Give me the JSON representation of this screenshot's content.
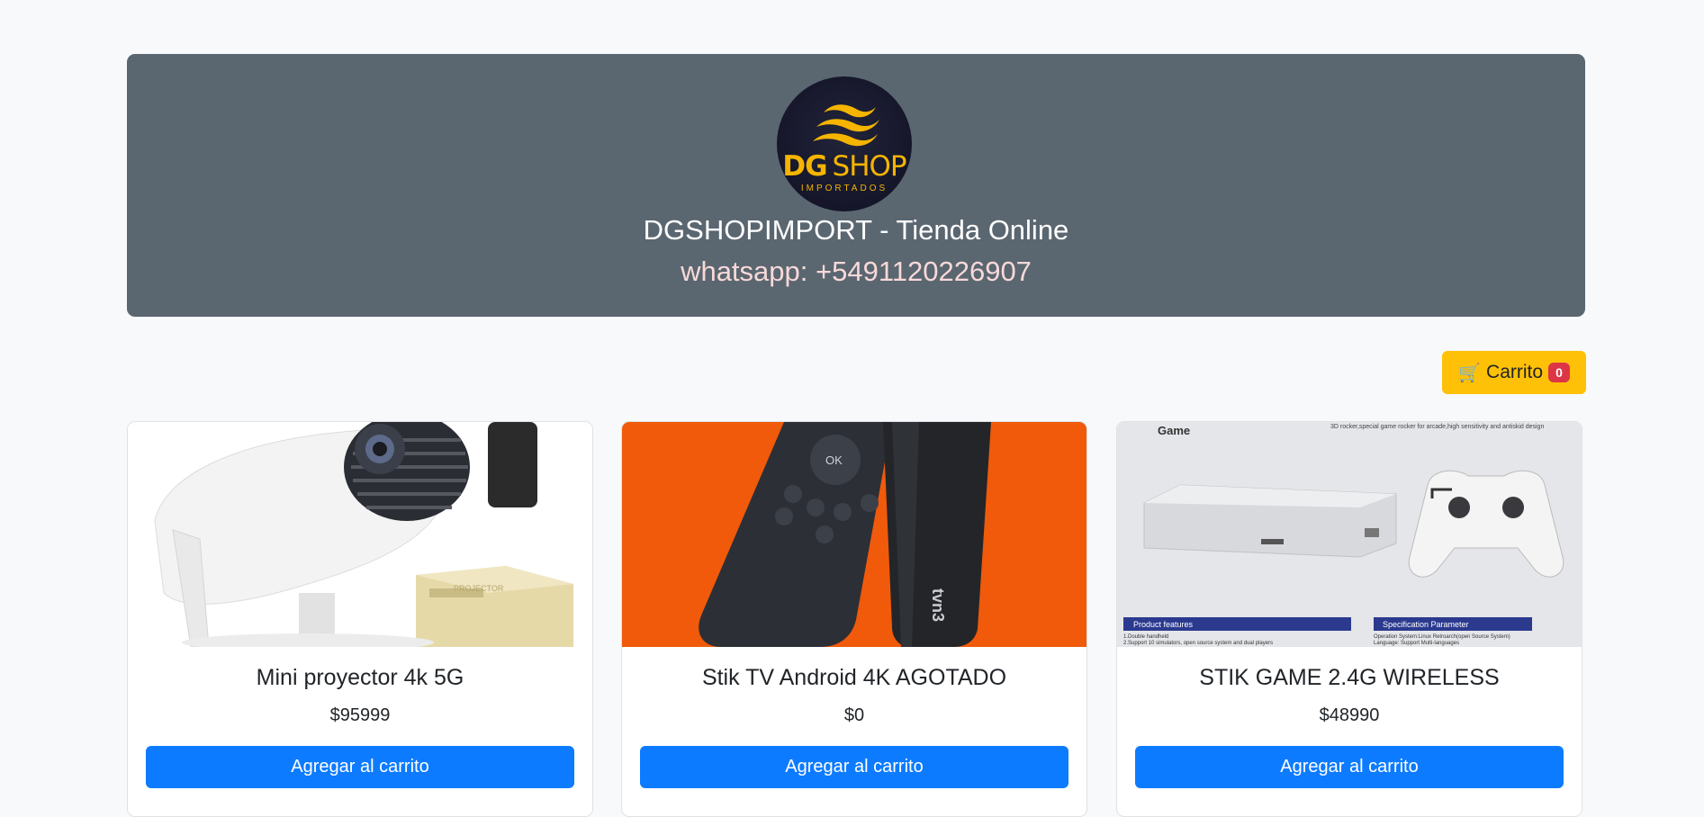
{
  "header": {
    "logo": {
      "brand_bold": "DG",
      "brand_light": "SHOP",
      "subtitle": "IMPORTADOS"
    },
    "title": "DGSHOPIMPORT - Tienda Online",
    "phone": "whatsapp: +5491120226907"
  },
  "cart": {
    "icon": "shopping-cart-icon",
    "label": "Carrito",
    "count": "0"
  },
  "products": [
    {
      "title": "Mini proyector 4k 5G",
      "price": "$95999",
      "button": "Agregar al carrito"
    },
    {
      "title": "Stik TV Android 4K AGOTADO",
      "price": "$0",
      "button": "Agregar al carrito"
    },
    {
      "title": "STIK GAME 2.4G WIRELESS",
      "price": "$48990",
      "button": "Agregar al carrito"
    }
  ],
  "product_images": {
    "remote_key": "OK",
    "stick_brand": "tvn3",
    "game_logo": "Game",
    "game_tagline": "3D rocker,special game rocker for arcade,high sensitivity and antiskid design",
    "features_title": "Product features",
    "features_lines": [
      "1.Double handheld",
      "2.Support 10 simulators, open source system and dual players"
    ],
    "spec_title": "Specification Parameter",
    "spec_lines": [
      "Operation System:Linux Retroarch(open Source System)",
      "Language: Support Multi-languages"
    ],
    "box_label": "PROJECTOR"
  },
  "colors": {
    "header_bg": "#5a6670",
    "cart_bg": "#ffc107",
    "badge_bg": "#dc3545",
    "primary": "#0d7bff",
    "logo_gold": "#f5b400"
  }
}
